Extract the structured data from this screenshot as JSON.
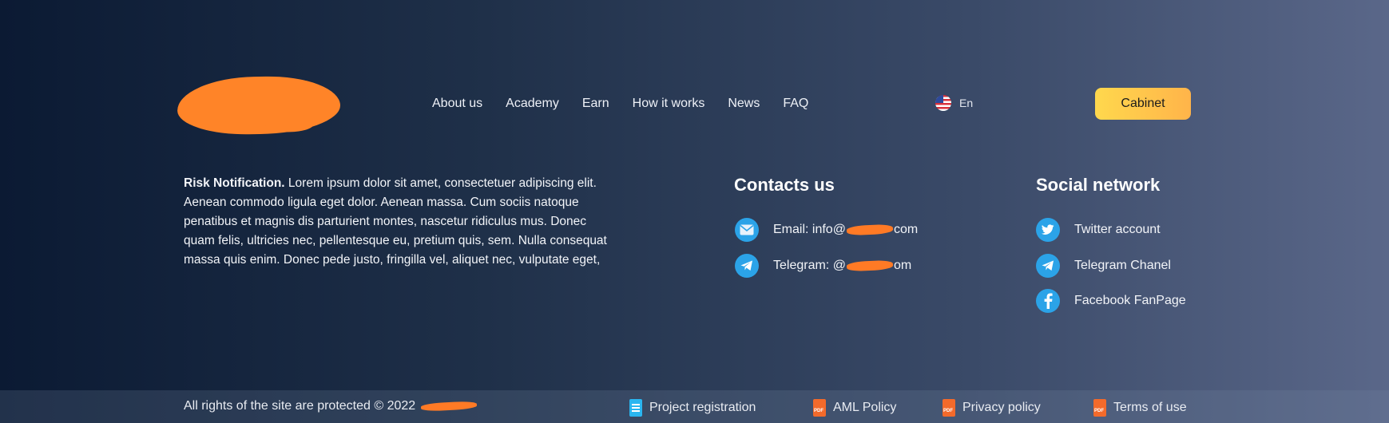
{
  "nav": {
    "items": [
      "About us",
      "Academy",
      "Earn",
      "How it works",
      "News",
      "FAQ"
    ]
  },
  "lang": {
    "label": "En",
    "flag_icon": "us-flag-icon"
  },
  "cabinet": {
    "label": "Cabinet"
  },
  "risk": {
    "title": "Risk Notification.",
    "text": " Lorem ipsum dolor sit amet, consectetuer adipiscing elit. Aenean commodo ligula eget dolor. Aenean massa. Cum sociis natoque penatibus et magnis dis parturient montes, nascetur ridiculus mus. Donec quam felis, ultricies nec, pellentesque eu, pretium quis, sem. Nulla consequat massa quis enim. Donec pede justo, fringilla vel, aliquet nec, vulputate eget,"
  },
  "contacts": {
    "title": "Contacts us",
    "email_prefix": "Email: info@",
    "email_suffix": "com",
    "telegram_prefix": "Telegram: @",
    "telegram_suffix": "om"
  },
  "social": {
    "title": "Social network",
    "twitter": "Twitter account",
    "telegram": "Telegram Chanel",
    "facebook": "Facebook FanPage"
  },
  "footer": {
    "copyright": "All rights of the site are protected © 2022",
    "project_registration": "Project registration",
    "aml": "AML Policy",
    "privacy": "Privacy policy",
    "terms": "Terms of use"
  },
  "colors": {
    "accent": "#ffc94d",
    "icon_blue": "#2ba3e8",
    "redaction": "#ff8428"
  }
}
